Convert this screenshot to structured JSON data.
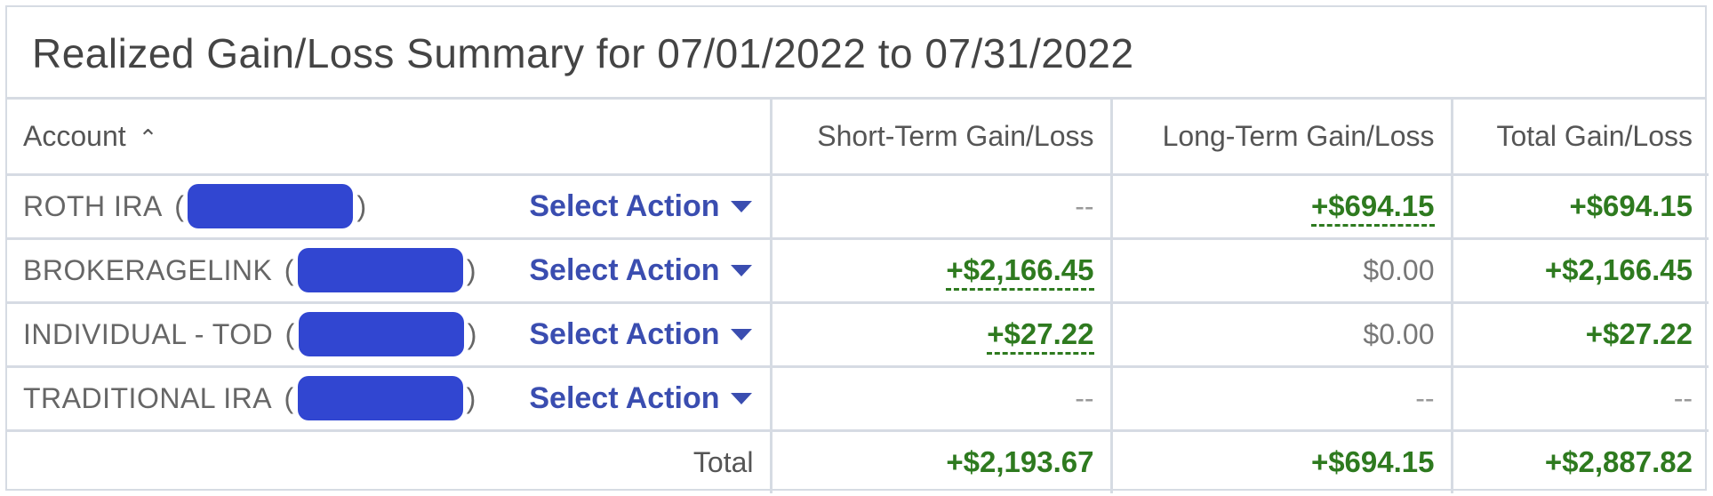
{
  "title": "Realized Gain/Loss Summary for 07/01/2022 to 07/31/2022",
  "columns": {
    "account": "Account",
    "short_term": "Short-Term Gain/Loss",
    "long_term": "Long-Term Gain/Loss",
    "total": "Total Gain/Loss"
  },
  "sort_icon": "chevron-up-icon",
  "rows": [
    {
      "account": "ROTH IRA",
      "action": "Select Action",
      "short_term": "--",
      "long_term": "+$694.15",
      "total": "+$694.15"
    },
    {
      "account": "BROKERAGELINK",
      "action": "Select Action",
      "short_term": "+$2,166.45",
      "long_term": "$0.00",
      "total": "+$2,166.45"
    },
    {
      "account": "INDIVIDUAL - TOD",
      "action": "Select Action",
      "short_term": "+$27.22",
      "long_term": "$0.00",
      "total": "+$27.22"
    },
    {
      "account": "TRADITIONAL IRA",
      "action": "Select Action",
      "short_term": "--",
      "long_term": "--",
      "total": "--"
    }
  ],
  "totals": {
    "label": "Total",
    "short_term": "+$2,193.67",
    "long_term": "+$694.15",
    "total": "+$2,887.82"
  },
  "colors": {
    "gain": "#2e7a1f",
    "link": "#3a4db0",
    "redaction": "#3146d1",
    "border": "#d6dbe3"
  }
}
